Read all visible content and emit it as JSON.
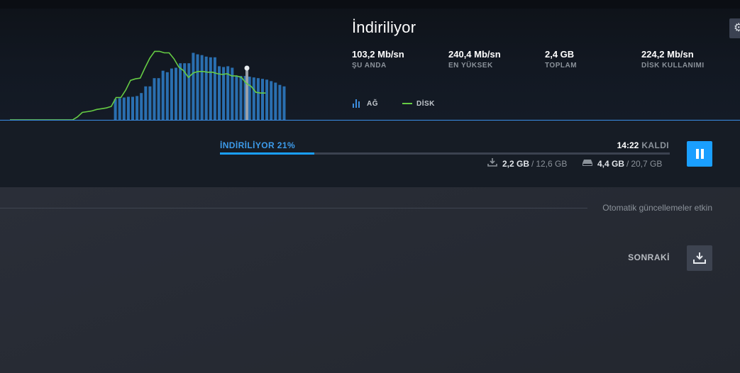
{
  "header": {
    "title": "İndiriliyor",
    "stats": [
      {
        "value": "103,2 Mb/sn",
        "label": "ŞU ANDA"
      },
      {
        "value": "240,4 Mb/sn",
        "label": "EN YÜKSEK"
      },
      {
        "value": "2,4 GB",
        "label": "TOPLAM"
      },
      {
        "value": "224,2 Mb/sn",
        "label": "DİSK KULLANIMI"
      }
    ],
    "legend": {
      "network": "AĞ",
      "disk": "DİSK"
    },
    "colors": {
      "network": "#2a6fb0",
      "disk": "#66cc44",
      "accent": "#1a9fff"
    }
  },
  "graph_data": {
    "network_bars": [
      0,
      0,
      0,
      0,
      0,
      0,
      0,
      0,
      0,
      0,
      0,
      0,
      0,
      0,
      0,
      0,
      0.28,
      0.29,
      0.3,
      0.31,
      0.31,
      0.32,
      0.36,
      0.45,
      0.45,
      0.56,
      0.56,
      0.66,
      0.64,
      0.69,
      0.7,
      0.76,
      0.76,
      0.76,
      0.9,
      0.88,
      0.87,
      0.85,
      0.84,
      0.84,
      0.72,
      0.71,
      0.72,
      0.7,
      0.59,
      0.59,
      0.59,
      0.58,
      0.57,
      0.56,
      0.55,
      0.54,
      0.52,
      0.5,
      0.47,
      0.45
    ],
    "disk_line": [
      0,
      0,
      0,
      0,
      0,
      0,
      0,
      0,
      0,
      0,
      0,
      0,
      0,
      0,
      0.04,
      0.1,
      0.11,
      0.12,
      0.14,
      0.15,
      0.16,
      0.18,
      0.3,
      0.3,
      0.4,
      0.53,
      0.55,
      0.56,
      0.7,
      0.83,
      0.92,
      0.92,
      0.9,
      0.9,
      0.82,
      0.71,
      0.66,
      0.57,
      0.63,
      0.65,
      0.65,
      0.64,
      0.64,
      0.62,
      0.61,
      0.62,
      0.59,
      0.59,
      0.57,
      0.49,
      0.45,
      0.37,
      0.36,
      0.36
    ]
  },
  "progress": {
    "label": "İNDİRİLİYOR 21%",
    "fraction": 0.21,
    "time": "14:22",
    "time_suffix": "KALDI",
    "download_done": "2,2 GB",
    "download_total": "12,6 GB",
    "disk_done": "4,4 GB",
    "disk_total": "20,7 GB",
    "separator": "/"
  },
  "queue": {
    "auto_updates": "Otomatik güncellemeler etkin",
    "next_label": "SONRAKİ"
  }
}
